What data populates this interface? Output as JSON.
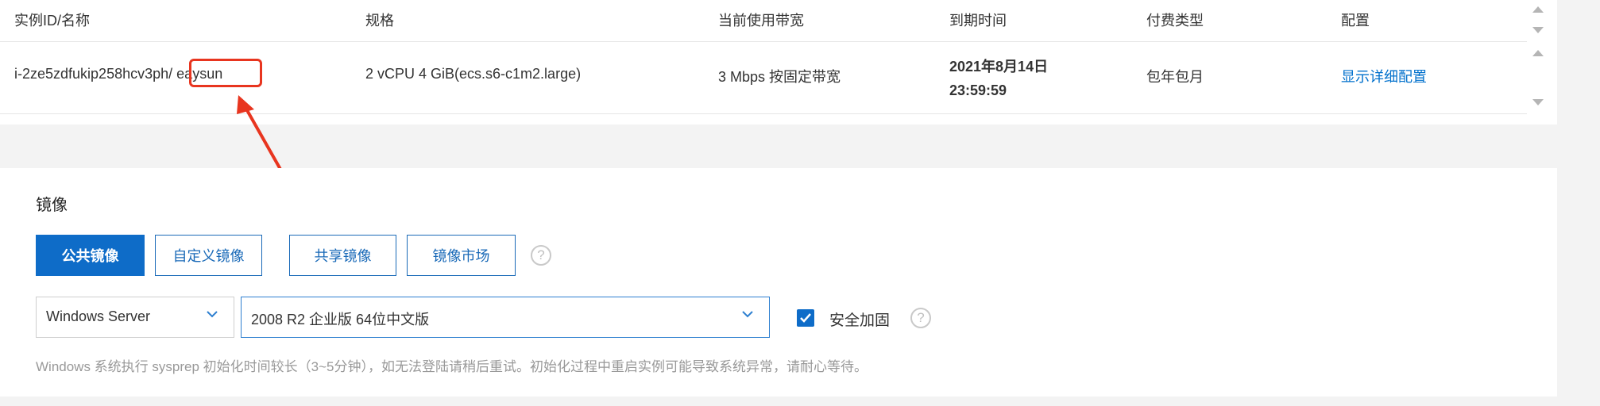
{
  "table": {
    "headers": {
      "instance": "实例ID/名称",
      "spec": "规格",
      "bandwidth": "当前使用带宽",
      "expiry": "到期时间",
      "billing": "付费类型",
      "config": "配置"
    },
    "row": {
      "instance_id": "i-2ze5zdfukip258hcv3ph",
      "separator": "/",
      "instance_name": "eaysun",
      "spec": "2 vCPU 4 GiB(ecs.s6-c1m2.large)",
      "bandwidth": "3 Mbps 按固定带宽",
      "expiry_date": "2021年8月14日",
      "expiry_time": "23:59:59",
      "billing": "包年包月",
      "config_link": "显示详细配置"
    }
  },
  "image_section": {
    "title": "镜像",
    "tabs": [
      {
        "label": "公共镜像",
        "active": true
      },
      {
        "label": "自定义镜像",
        "active": false
      },
      {
        "label": "共享镜像",
        "active": false
      },
      {
        "label": "镜像市场",
        "active": false
      }
    ],
    "help_icon": "?",
    "os_select": "Windows Server",
    "version_select": "2008 R2 企业版 64位中文版",
    "security_checkbox": {
      "label": "安全加固",
      "checked": true
    },
    "hint": "Windows 系统执行 sysprep 初始化时间较长（3~5分钟），如无法登陆请稍后重试。初始化过程中重启实例可能导致系统异常，请耐心等待。"
  },
  "colors": {
    "primary": "#0e6cc8",
    "link": "#0070cc",
    "annotation": "#e8351f"
  }
}
